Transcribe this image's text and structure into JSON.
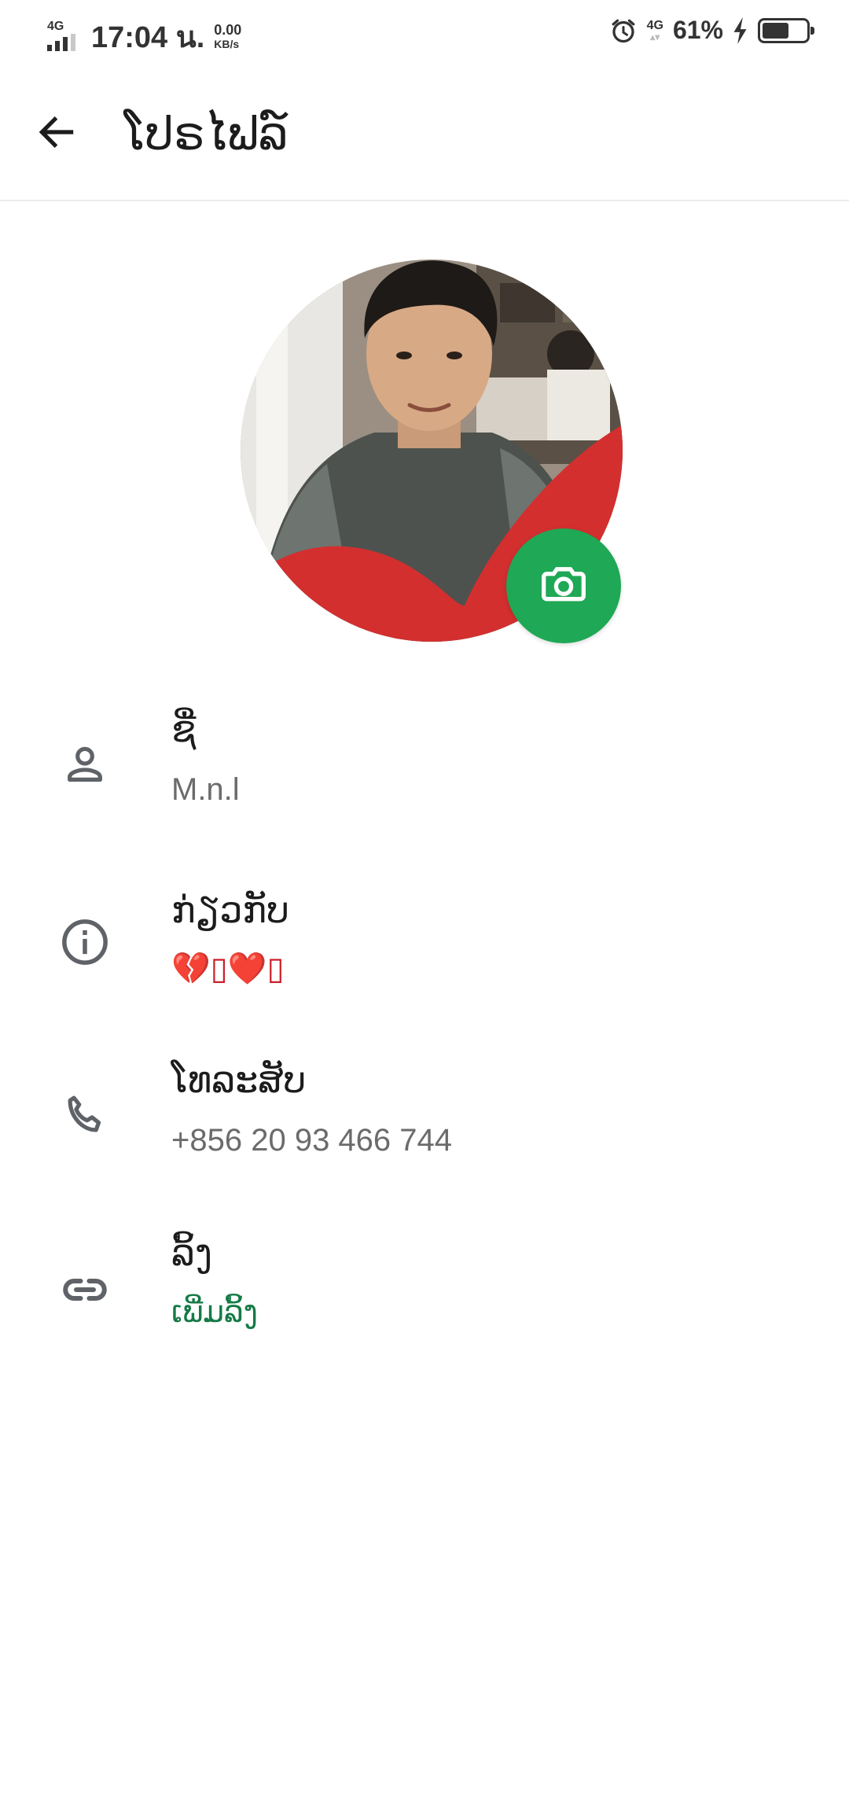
{
  "status_bar": {
    "network_left": "4G",
    "time": "17:04 น.",
    "speed_value": "0.00",
    "speed_unit": "KB/s",
    "network_right": "4G",
    "battery_percent": "61%",
    "battery_level": 0.61,
    "icons": [
      "signal-icon",
      "alarm-icon",
      "charging-icon",
      "battery-icon"
    ]
  },
  "app_bar": {
    "back_icon": "arrow-left-icon",
    "title": "ໂປຣໄຟລ໌"
  },
  "avatar": {
    "camera_icon": "camera-icon",
    "colors": {
      "camera_button": "#1fa855",
      "heart_overlay": "#d32f2f"
    }
  },
  "rows": [
    {
      "icon": "person-icon",
      "label": "ຊື່",
      "value": "M.n.l"
    },
    {
      "icon": "info-icon",
      "label": "ກ່ຽວກັບ",
      "value": "💔▯❤️▯"
    },
    {
      "icon": "phone-icon",
      "label": "ໂທລະສັບ",
      "value": "+856 20 93 466 744"
    },
    {
      "icon": "link-icon",
      "label": "ລິ້ງ",
      "value": "ເພີ່ມລິ້ງ"
    }
  ],
  "colors": {
    "accent_green": "#1fa855",
    "link_green": "#157a45",
    "icon_gray": "#5f6368"
  }
}
